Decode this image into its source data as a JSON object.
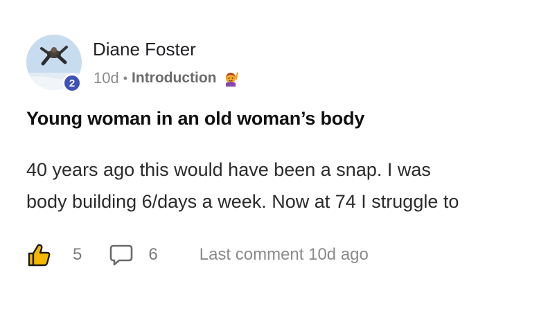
{
  "post": {
    "author": {
      "name": "Diane Foster",
      "level": "2"
    },
    "meta": {
      "age": "10d",
      "separator": "•",
      "category": "Introduction",
      "category_icon": "person-raising-hand-emoji"
    },
    "title": "Young woman in an old woman’s body",
    "body": "40 years ago this would have been a snap. I was\nbody building 6/days a week. Now at 74 I struggle to",
    "likes": "5",
    "comments": "6",
    "last_comment": "Last comment 10d ago"
  },
  "colors": {
    "badge": "#3f51b5",
    "like_icon": "#f5b800",
    "text_muted": "#8a8a8a"
  }
}
